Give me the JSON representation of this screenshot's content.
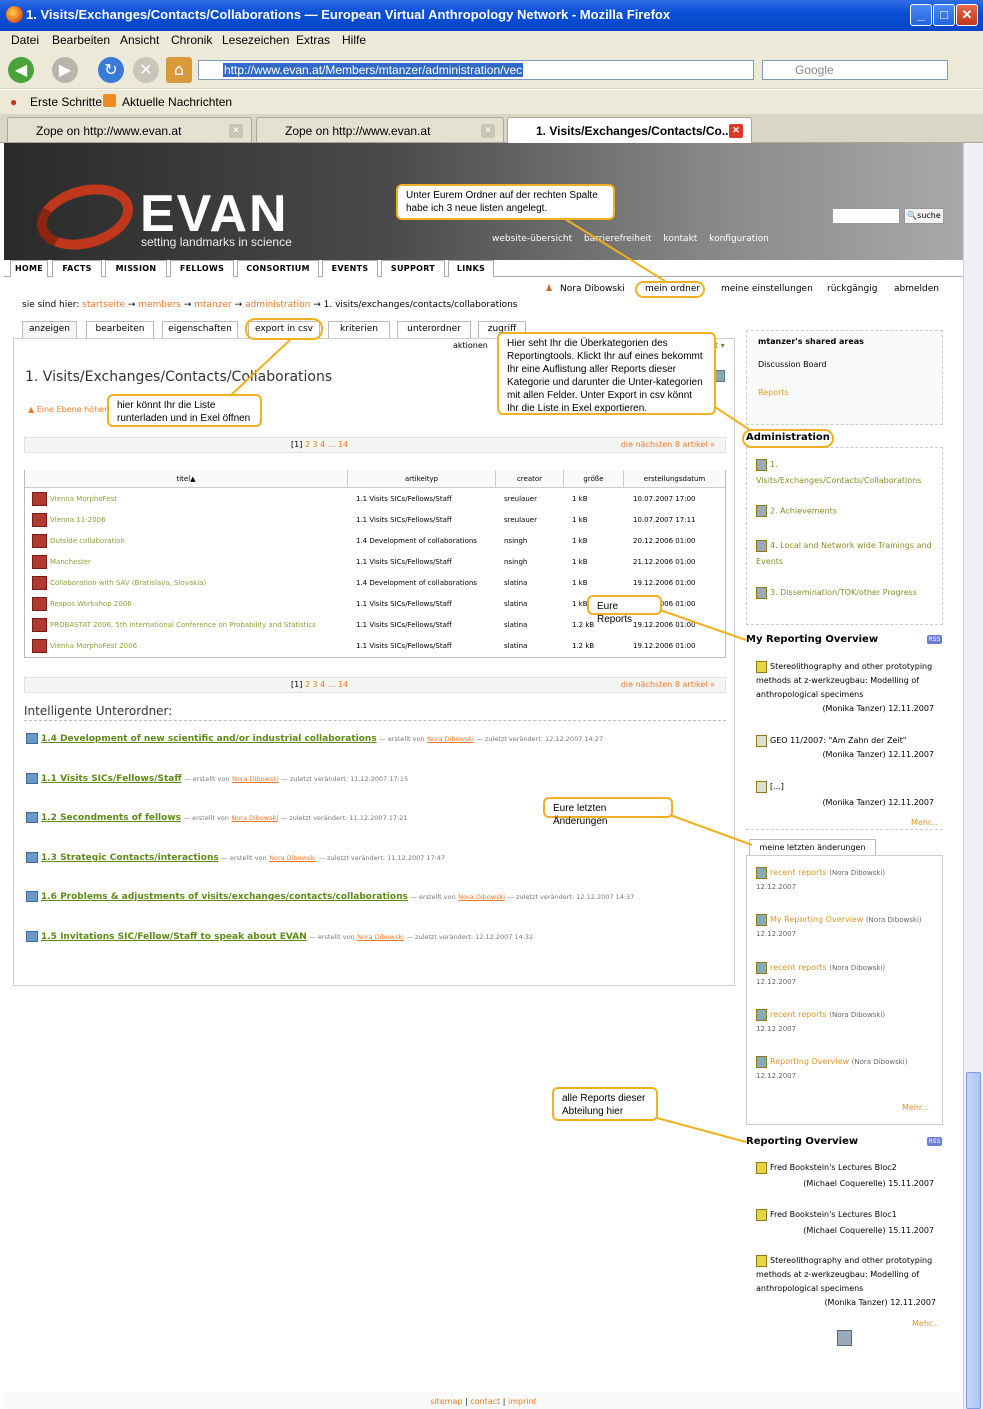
{
  "window": {
    "title": "1. Visits/Exchanges/Contacts/Collaborations — European Virtual Anthropology Network - Mozilla Firefox"
  },
  "menu": [
    "Datei",
    "Bearbeiten",
    "Ansicht",
    "Chronik",
    "Lesezeichen",
    "Extras",
    "Hilfe"
  ],
  "url": "http://www.evan.at/Members/mtanzer/administration/vec",
  "search_placeholder": "Google",
  "bookmarks": [
    "Erste Schritte",
    "Aktuelle Nachrichten"
  ],
  "tabs": [
    "Zope on http://www.evan.at",
    "Zope on http://www.evan.at",
    "1. Visits/Exchanges/Contacts/Co..."
  ],
  "site": {
    "logo": "EVAN",
    "tagline": "setting landmarks in science",
    "header_links": [
      "website-übersicht",
      "barrierefreiheit",
      "kontakt",
      "konfiguration"
    ],
    "search_button": "suche"
  },
  "main_nav": [
    "HOME",
    "FACTS",
    "MISSION",
    "FELLOWS",
    "CONSORTIUM",
    "EVENTS",
    "SUPPORT",
    "LINKS"
  ],
  "userbar": {
    "user": "Nora Dibowski",
    "links": [
      "mein ordner",
      "meine einstellungen",
      "rückgängig",
      "abmelden"
    ]
  },
  "breadcrumb": {
    "label": "sie sind hier:",
    "items": [
      "startseite",
      "members",
      "mtanzer",
      "administration"
    ],
    "current": "1. visits/exchanges/contacts/collaborations"
  },
  "content_tabs": [
    "anzeigen",
    "bearbeiten",
    "eigenschaften",
    "export in csv",
    "kriterien",
    "unterordner",
    "zugriff"
  ],
  "actions": "aktionen",
  "page_title": "1. Visits/Exchanges/Contacts/Collaborations",
  "up_link": "Eine Ebene höher",
  "pager": {
    "current": "[1]",
    "pages": "2 3 4 ... 14",
    "next": "die nächsten 8 artikel »"
  },
  "table": {
    "headers": [
      "titel▲",
      "artikeltyp",
      "creator",
      "größe",
      "erstellungsdatum"
    ],
    "rows": [
      [
        "Vienna MorphoFest",
        "1.1 Visits SICs/Fellows/Staff",
        "sreulauer",
        "1 kB",
        "10.07.2007 17:00"
      ],
      [
        "Vienna 11-2006",
        "1.1 Visits SICs/Fellows/Staff",
        "sreulauer",
        "1 kB",
        "10.07.2007 17:11"
      ],
      [
        "Outside collaboration",
        "1.4 Development of collaborations",
        "nsingh",
        "1 kB",
        "20.12.2006 01:00"
      ],
      [
        "Manchester",
        "1.1 Visits SICs/Fellows/Staff",
        "nsingh",
        "1 kB",
        "21.12.2006 01:00"
      ],
      [
        "Collaboration with SAV (Bratislava, Slovakia)",
        "1.4 Development of collaborations",
        "slatina",
        "1 kB",
        "19.12.2006 01:00"
      ],
      [
        "Respos Workshop 2006",
        "1.1 Visits SICs/Fellows/Staff",
        "slatina",
        "1 kB",
        "19.12.2006 01:00"
      ],
      [
        "PROBASTAT 2006, 5th International Conference on Probability and Statistics",
        "1.1 Visits SICs/Fellows/Staff",
        "slatina",
        "1.2 kB",
        "19.12.2006 01:00"
      ],
      [
        "Vienna MorphoFest 2006",
        "1.1 Visits SICs/Fellows/Staff",
        "slatina",
        "1.2 kB",
        "19.12.2006 01:00"
      ]
    ]
  },
  "intelligent": {
    "heading": "Intelligente Unterordner:",
    "items": [
      {
        "title": "1.4 Development of new scientific and/or industrial collaborations",
        "meta1": "— erstellt von",
        "author": "Nora Dibowski",
        "meta2": "— zuletzt verändert: 12.12.2007 14:27"
      },
      {
        "title": "1.1 Visits SICs/Fellows/Staff",
        "meta1": "— erstellt von",
        "author": "Nora Dibowski",
        "meta2": "— zuletzt verändert: 11.12.2007 17:15"
      },
      {
        "title": "1.2 Secondments of fellows",
        "meta1": "— erstellt von",
        "author": "Nora Dibowski",
        "meta2": "— zuletzt verändert: 11.12.2007 17:21"
      },
      {
        "title": "1.3 Strategic Contacts/interactions",
        "meta1": "— erstellt von",
        "author": "Nora Dibowski",
        "meta2": "— zuletzt verändert: 11.12.2007 17:47"
      },
      {
        "title": "1.6 Problems & adjustments of visits/exchanges/contacts/collaborations",
        "meta1": "— erstellt von",
        "author": "Nora Dibowski",
        "meta2": "— zuletzt verändert: 12.12.2007 14:37"
      },
      {
        "title": "1.5 Invitations SIC/Fellow/Staff to speak about EVAN",
        "meta1": "— erstellt von",
        "author": "Nora Dibowski",
        "meta2": "— zuletzt verändert: 12.12.2007 14:32"
      }
    ]
  },
  "sidebar": {
    "shared": {
      "title": "mtanzer's shared areas",
      "items": [
        "Discussion Board",
        "Reports"
      ]
    },
    "administration": {
      "title": "Administration",
      "items": [
        "1. Visits/Exchanges/Contacts/Collaborations",
        "2. Achievements",
        "4. Local and Network wide Trainings and Events",
        "3. Dissemination/TOK/other Progress"
      ]
    },
    "my_reporting": {
      "title": "My Reporting Overview",
      "items": [
        {
          "text": "Stereolithography and other prototyping methods at z-werkzeugbau: Modelling of anthropological specimens",
          "by": "(Monika Tanzer) 12.11.2007"
        },
        {
          "text": "GEO 11/2007: \"Am Zahn der Zeit\"",
          "by": "(Monika Tanzer) 12.11.2007"
        },
        {
          "text": "[...]",
          "by": "(Monika Tanzer) 12.11.2007"
        }
      ],
      "more": "Mehr..."
    },
    "recent": {
      "tab": "meine letzten änderungen",
      "items": [
        {
          "title": "recent reports",
          "who": "(Nora Dibowski)",
          "date": "12.12.2007"
        },
        {
          "title": "My Reporting Overview",
          "who": "(Nora Dibowski)",
          "date": "12.12.2007"
        },
        {
          "title": "recent reports",
          "who": "(Nora Dibowski)",
          "date": "12.12.2007"
        },
        {
          "title": "recent reports",
          "who": "(Nora Dibowski)",
          "date": "12.12.2007"
        },
        {
          "title": "Reporting Overview",
          "who": "(Nora Dibowski)",
          "date": "12.12.2007"
        }
      ],
      "more": "Mehr..."
    },
    "reporting": {
      "title": "Reporting Overview",
      "items": [
        {
          "text": "Fred Bookstein's Lectures Bloc2",
          "by": "(Michael Coquerelle) 15.11.2007"
        },
        {
          "text": "Fred Bookstein's Lectures Bloc1",
          "by": "(Michael Coquerelle) 15.11.2007"
        },
        {
          "text": "Stereolithography and other prototyping methods at z-werkzeugbau: Modelling of anthropological specimens",
          "by": "(Monika Tanzer) 12.11.2007"
        }
      ],
      "more": "Mehr..."
    }
  },
  "notes": {
    "n1": "Unter Eurem Ordner auf der rechten Spalte habe ich 3 neue listen angelegt.",
    "n2": "Hier seht Ihr die Überkategorien des Reportingtools. Klickt Ihr auf eines bekommt Ihr eine Auflistung aller Reports dieser Kategorie und darunter die Unter-kategorien mit allen Felder.  Unter Export in csv könnt Ihr die Liste in Exel exportieren.",
    "n3": "hier könnt Ihr die Liste runterladen und in Exel öffnen",
    "n4": "Eure Reports",
    "n5": "Eure letzten Änderungen",
    "n6": "alle Reports dieser Abteilung hier"
  },
  "footer": [
    "sitemap",
    "contact",
    "imprint"
  ]
}
